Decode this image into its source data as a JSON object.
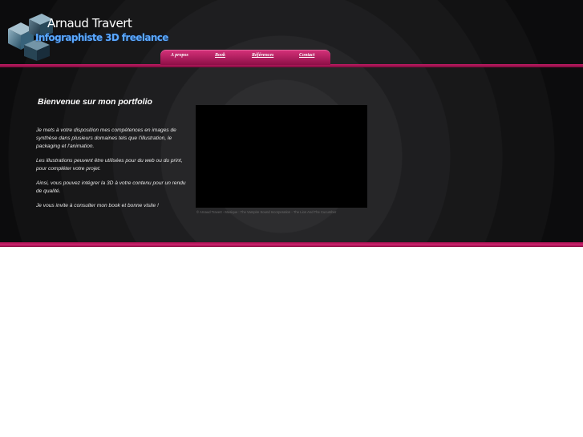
{
  "header": {
    "brand_name": "Arnaud Travert",
    "tagline": "Infographiste 3D freelance"
  },
  "nav": {
    "items": [
      {
        "label": "A propos"
      },
      {
        "label": "Book"
      },
      {
        "label": "Références"
      },
      {
        "label": "Contact"
      }
    ]
  },
  "main": {
    "title": "Bienvenue sur mon portfolio",
    "paragraphs": [
      "Je mets à votre disposition mes compétences en images de synthèse dans plusieurs domaines tels que l'illustration, le packaging et l'animation.",
      "Les illustrations peuvent être utilisées pour du web ou du print, pour compléter votre projet.",
      "Ainsi, vous pouvez intégrer la 3D à votre contenu pour un rendu de qualité.",
      "Je vous invite à consulter mon book et bonne visite !"
    ],
    "video_caption": "© Arnaud Travert - Musique : The Vampire Sound Incorporation - The Lion And The Cucumber"
  },
  "colors": {
    "accent": "#c41c66",
    "tagline": "#5aa8ff",
    "background": "#121213"
  },
  "icons": {
    "logo": "cubes-logo-icon"
  }
}
